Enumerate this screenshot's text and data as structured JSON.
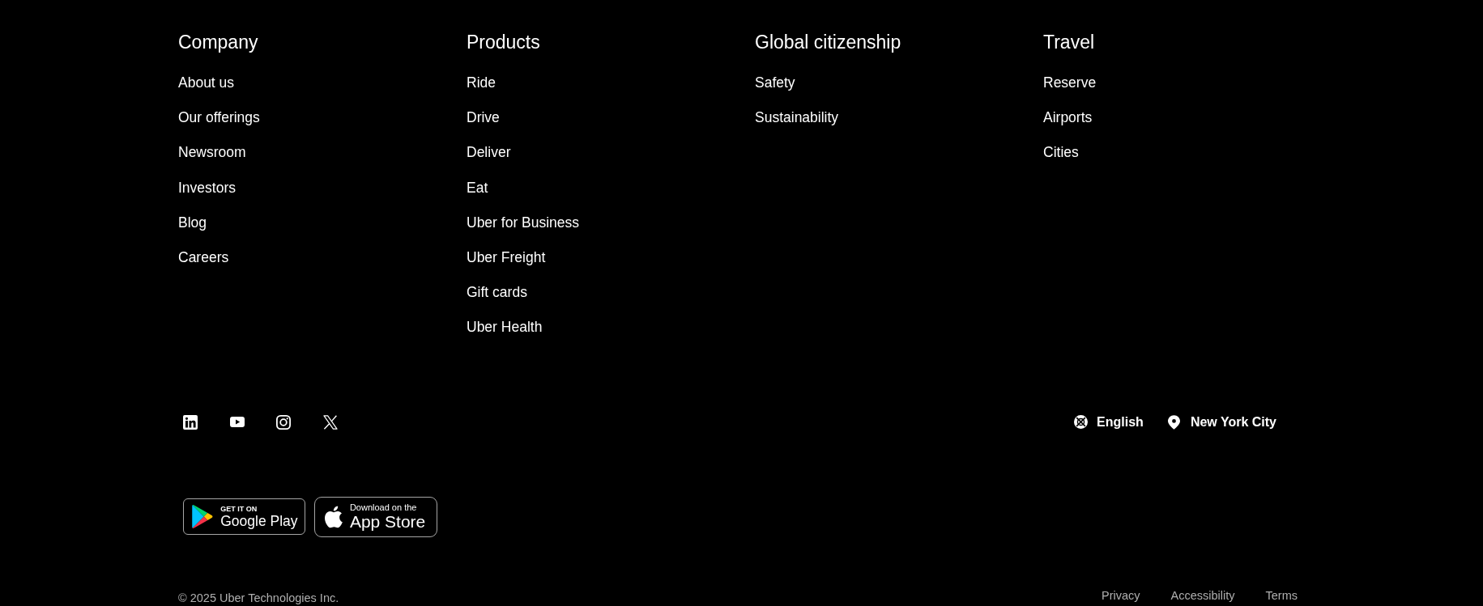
{
  "footer_columns": [
    {
      "heading": "Company",
      "links": [
        "About us",
        "Our offerings",
        "Newsroom",
        "Investors",
        "Blog",
        "Careers"
      ]
    },
    {
      "heading": "Products",
      "links": [
        "Ride",
        "Drive",
        "Deliver",
        "Eat",
        "Uber for Business",
        "Uber Freight",
        "Gift cards",
        "Uber Health"
      ]
    },
    {
      "heading": "Global citizenship",
      "links": [
        "Safety",
        "Sustainability"
      ]
    },
    {
      "heading": "Travel",
      "links": [
        "Reserve",
        "Airports",
        "Cities"
      ]
    }
  ],
  "locale": {
    "language": "English",
    "city": "New York City"
  },
  "app_badges": [
    {
      "kind": "google_play",
      "caption": "GET IT ON",
      "store": "Google Play"
    },
    {
      "kind": "app_store",
      "caption": "Download on the",
      "store": "App Store"
    }
  ],
  "legal": {
    "copyright": "© 2025 Uber Technologies Inc.",
    "links": [
      "Privacy",
      "Accessibility",
      "Terms"
    ]
  }
}
